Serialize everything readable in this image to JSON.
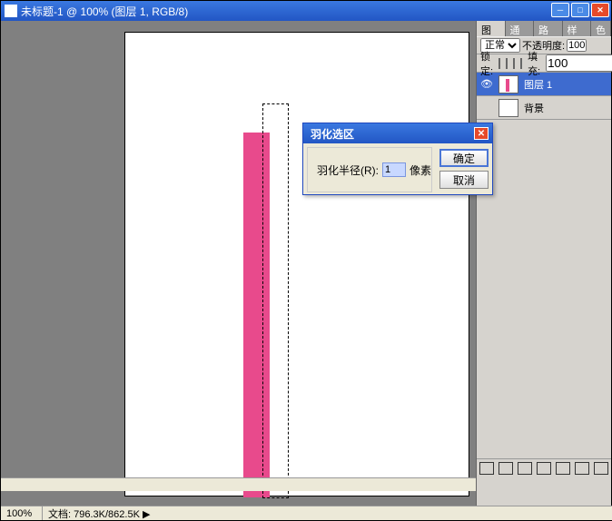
{
  "window": {
    "title": "未标题-1 @ 100% (图层 1, RGB/8)"
  },
  "status": {
    "zoom": "100%",
    "doc_label": "文档:",
    "doc_size": "796.3K/862.5K"
  },
  "panels": {
    "tabs": {
      "layers": "图层",
      "channels": "通道",
      "paths": "路径",
      "styles": "样式",
      "colors": "色"
    },
    "blend_modes": {
      "normal": "正常"
    },
    "opacity": {
      "label": "不透明度:",
      "value": "100"
    },
    "lock": {
      "label": "锁定:",
      "fill_label": "填充:",
      "fill_value": "100"
    },
    "layer1": "图层 1",
    "bg_layer": "背景"
  },
  "dialog": {
    "title": "羽化选区",
    "radius_label": "羽化半径(R):",
    "radius_value": "1",
    "unit": "像素",
    "ok": "确定",
    "cancel": "取消"
  }
}
